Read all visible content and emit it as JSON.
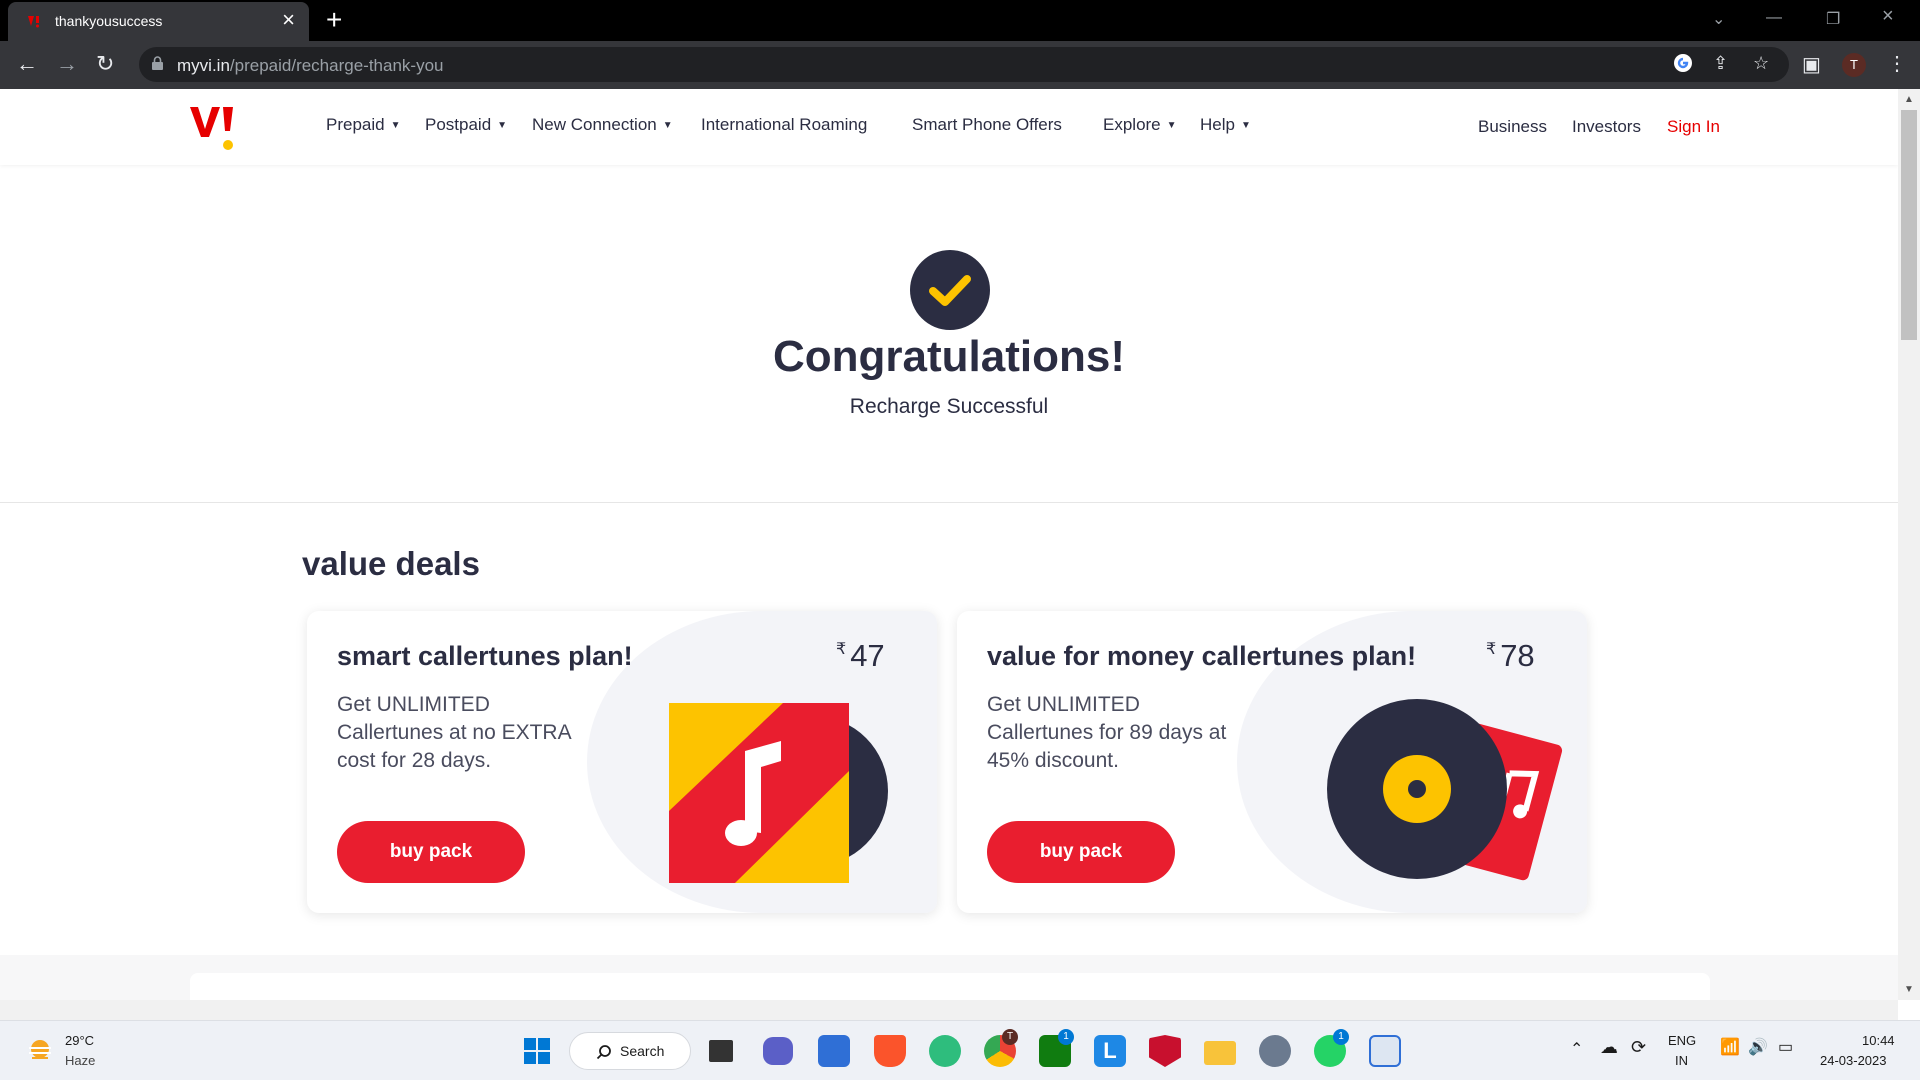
{
  "browser": {
    "tab_title": "thankyousuccess",
    "tab_favicon": "vi-favicon",
    "url_domain": "myvi.in",
    "url_path": "/prepaid/recharge-thank-you",
    "profile_initial": "T"
  },
  "header": {
    "nav": [
      "Prepaid",
      "Postpaid",
      "New Connection",
      "International Roaming",
      "Smart Phone Offers",
      "Explore",
      "Help"
    ],
    "right": {
      "business": "Business",
      "investors": "Investors",
      "sign_in": "Sign In"
    }
  },
  "success": {
    "title": "Congratulations!",
    "subtitle": "Recharge Successful"
  },
  "deals": {
    "title": "value deals",
    "cards": [
      {
        "title": "smart callertunes plan!",
        "currency": "₹",
        "price": "47",
        "description": "Get UNLIMITED Callertunes at no EXTRA cost for 28 days.",
        "button": "buy pack"
      },
      {
        "title": "value for money callertunes plan!",
        "currency": "₹",
        "price": "78",
        "description": "Get UNLIMITED Callertunes for 89 days at 45% discount.",
        "button": "buy pack"
      }
    ]
  },
  "taskbar": {
    "weather": {
      "temp": "29°C",
      "condition": "Haze"
    },
    "search": "Search",
    "lang_top": "ENG",
    "lang_bottom": "IN",
    "time": "10:44",
    "date": "24-03-2023",
    "badges": {
      "chrome": "T",
      "xbox": "1",
      "whatsapp": "1"
    }
  },
  "colors": {
    "brand_red": "#e60000",
    "button_red": "#e91e2f",
    "navy": "#2b2d42",
    "yellow": "#fdc300"
  }
}
